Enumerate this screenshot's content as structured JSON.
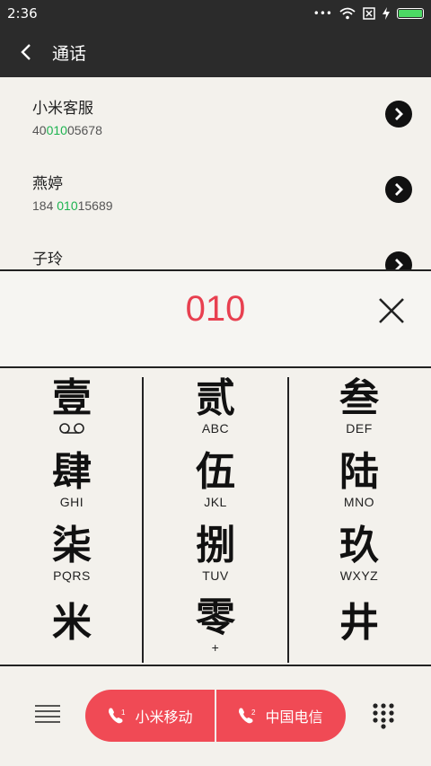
{
  "status": {
    "time": "2:36",
    "icons": [
      "more-icon",
      "wifi-icon",
      "sim-icon",
      "charging-icon",
      "battery-icon"
    ]
  },
  "appbar": {
    "title": "通话"
  },
  "results": [
    {
      "name": "小米客服",
      "number_pre": "40",
      "number_hl": "010",
      "number_post": "05678"
    },
    {
      "name": "燕婷",
      "number_pre": "184 ",
      "number_hl": "010",
      "number_post": "15689"
    },
    {
      "name": "子玲",
      "number_pre": "",
      "number_hl": "",
      "number_post": ""
    }
  ],
  "input": {
    "digits": "010"
  },
  "keypad": [
    {
      "glyph": "壹",
      "sub": ""
    },
    {
      "glyph": "贰",
      "sub": "ABC"
    },
    {
      "glyph": "叁",
      "sub": "DEF"
    },
    {
      "glyph": "肆",
      "sub": "GHI"
    },
    {
      "glyph": "伍",
      "sub": "JKL"
    },
    {
      "glyph": "陆",
      "sub": "MNO"
    },
    {
      "glyph": "柒",
      "sub": "PQRS"
    },
    {
      "glyph": "捌",
      "sub": "TUV"
    },
    {
      "glyph": "玖",
      "sub": "WXYZ"
    },
    {
      "glyph": "米",
      "sub": ""
    },
    {
      "glyph": "零",
      "sub": "+"
    },
    {
      "glyph": "井",
      "sub": ""
    }
  ],
  "bottom": {
    "sim1_label": "小米移动",
    "sim1_index": "1",
    "sim2_label": "中国电信",
    "sim2_index": "2"
  },
  "colors": {
    "accent": "#f04a55",
    "digits": "#e84050",
    "highlight": "#1db350",
    "topbar": "#2b2b2b"
  }
}
